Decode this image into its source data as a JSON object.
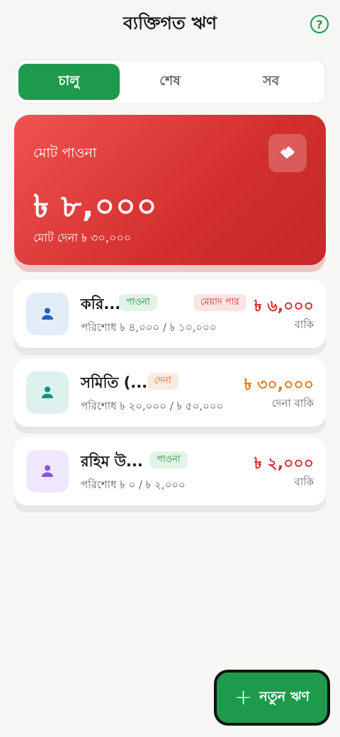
{
  "header": {
    "title": "ব্যক্তিগত ঋণ",
    "help_icon": "help-circle-icon",
    "help_glyph": "?"
  },
  "tabs": [
    {
      "label": "চালু",
      "active": true
    },
    {
      "label": "শেষ",
      "active": false
    },
    {
      "label": "সব",
      "active": false
    }
  ],
  "summary": {
    "label": "মোট পাওনা",
    "amount": "৳ ৮,০০০",
    "sub": "মোট দেনা ৳ ৩০,০০০",
    "icon": "handshake-icon"
  },
  "loans": [
    {
      "name": "করি...",
      "badge": "পাওনা",
      "overdue": "মেয়াদ পার",
      "progress": "পরিশোধ ৳ ৪,০০০ / ৳ ১০,০০০",
      "amount": "৳ ৬,০০০",
      "status": "বাকি"
    },
    {
      "name": "সমিতি (...",
      "badge": "দেনা",
      "progress": "পরিশোধ ৳ ২০,০০০ / ৳ ৫০,০০০",
      "amount": "৳ ৩০,০০০",
      "status": "দেনা বাকি"
    },
    {
      "name": "রহিম উ...",
      "badge": "পাওনা",
      "progress": "পরিশোধ ৳ ০ / ৳ ২,০০০",
      "amount": "৳ ২,০০০",
      "status": "বাকি"
    }
  ],
  "fab": {
    "label": "নতুন ঋণ",
    "icon": "plus-icon",
    "glyph": "+"
  },
  "colors": {
    "primary": "#1e9a4c",
    "danger": "#d32f2f",
    "warning": "#e07a1f",
    "avatar_blue": "#1e63b8",
    "avatar_teal": "#12917f",
    "avatar_purple": "#8a55e0"
  }
}
